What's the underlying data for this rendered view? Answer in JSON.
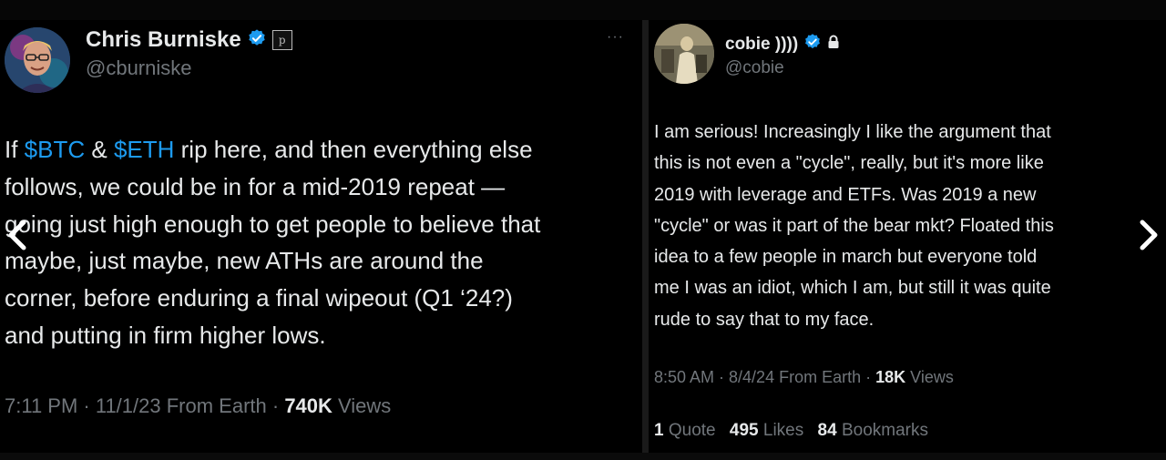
{
  "left_tweet": {
    "author_name": "Chris Burniske",
    "handle": "@cburniske",
    "affiliate_badge": "p",
    "more_label": "···",
    "body": {
      "t1": "If ",
      "btc": "$BTC",
      "t2": " & ",
      "eth": "$ETH",
      "t3": " rip here, and then everything else\nfollows, we could be in for a mid-2019 repeat —\ngoing just high enough to get people to believe that\nmaybe, just maybe, new ATHs are around the\ncorner, before enduring a final wipeout (Q1 ‘24?)\nand putting in firm higher lows."
    },
    "meta": {
      "time_date": "7:11 PM · 11/1/23 From Earth · ",
      "views_count": "740K",
      "views_label": " Views"
    }
  },
  "right_tweet": {
    "author_name": "cobie ))))",
    "handle": "@cobie",
    "body": "I am serious! Increasingly I like the argument that\nthis is not even a \"cycle\", really, but it's more like\n2019 with leverage and ETFs. Was 2019 a new\n\"cycle\" or was it part of the bear mkt? Floated this\nidea to a few people in march but everyone told\nme I was an idiot, which I am, but still it was quite\nrude to say that to my face.",
    "meta": {
      "time_date": "8:50 AM · 8/4/24 From Earth · ",
      "views_count": "18K",
      "views_label": " Views"
    },
    "stats": {
      "quotes_count": "1",
      "quotes_label": " Quote",
      "likes_count": "495",
      "likes_label": " Likes",
      "bookmarks_count": "84",
      "bookmarks_label": " Bookmarks"
    }
  },
  "navigation": {
    "prev_icon": "chevron-left-icon",
    "next_icon": "chevron-right-icon"
  },
  "colors": {
    "background": "#000000",
    "text_primary": "#e7e9ea",
    "text_secondary": "#71767b",
    "link_blue": "#1d9bf0",
    "verified_blue": "#1d9bf0"
  }
}
